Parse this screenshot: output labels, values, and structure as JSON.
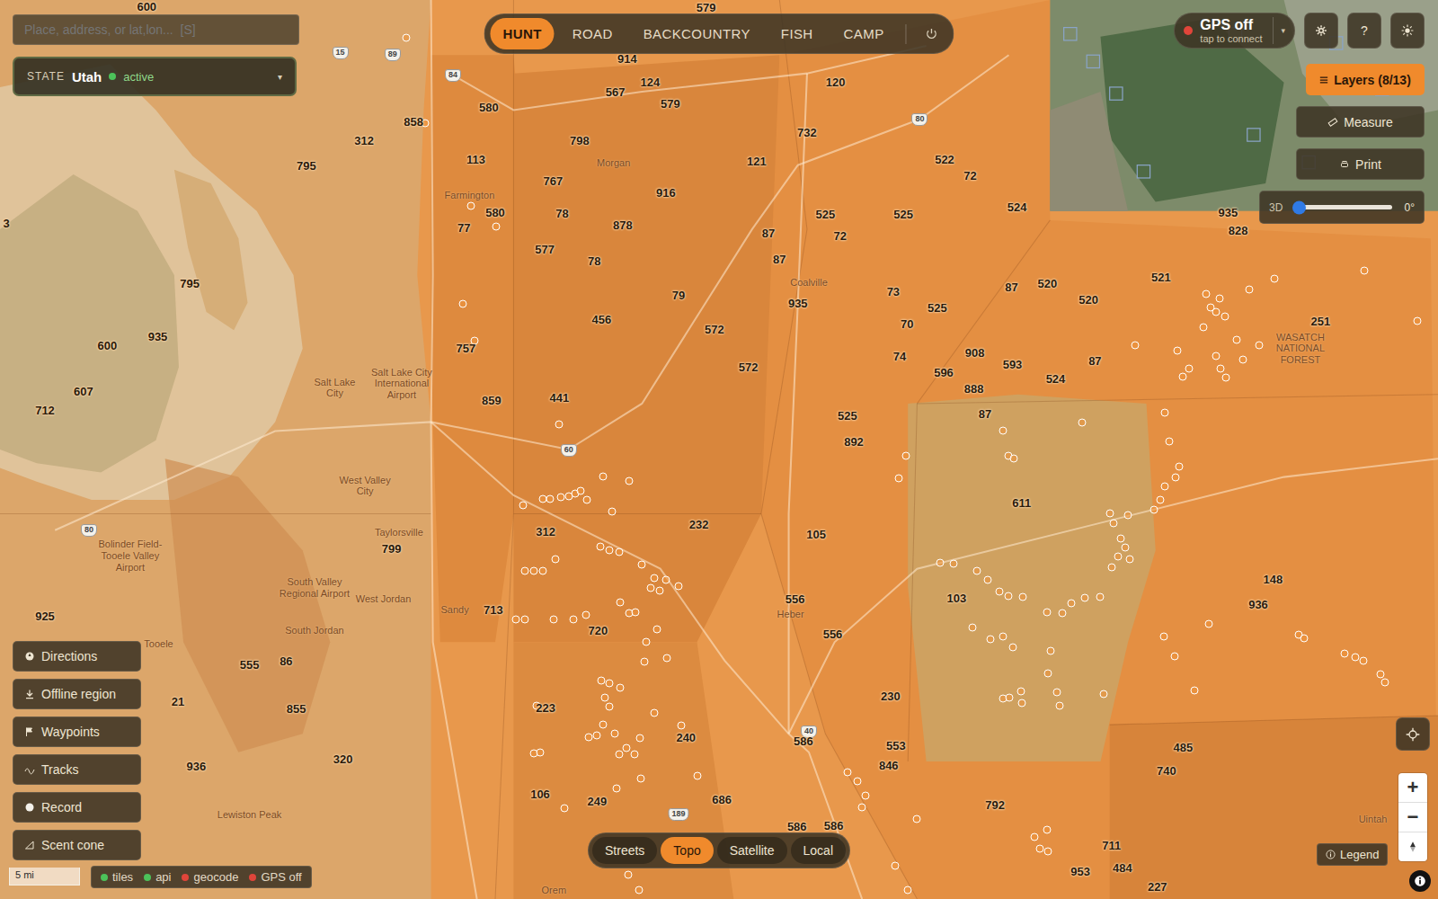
{
  "search": {
    "placeholder": "Place, address, or lat,lon...  [S]"
  },
  "state_selector": {
    "label": "STATE",
    "value": "Utah",
    "status": "active",
    "status_color": "#4cc25a",
    "caret": "▾"
  },
  "modes": [
    {
      "label": "HUNT",
      "selected": true
    },
    {
      "label": "ROAD",
      "selected": false
    },
    {
      "label": "BACKCOUNTRY",
      "selected": false
    },
    {
      "label": "FISH",
      "selected": false
    },
    {
      "label": "CAMP",
      "selected": false
    }
  ],
  "gps": {
    "title": "GPS off",
    "subtitle": "tap to connect",
    "color": "#e0453a",
    "caret": "▾"
  },
  "help": "?",
  "layers": {
    "label": "Layers (8/13)"
  },
  "tools": [
    {
      "label": "Measure"
    },
    {
      "label": "Print"
    }
  ],
  "tilt": {
    "label": "3D",
    "level": 0,
    "reading": "0°"
  },
  "side_buttons": [
    {
      "label": "Directions"
    },
    {
      "label": "Offline region"
    },
    {
      "label": "Waypoints"
    },
    {
      "label": "Tracks"
    },
    {
      "label": "Record"
    },
    {
      "label": "Scent cone"
    }
  ],
  "scale": "5 mi",
  "status": [
    {
      "label": "tiles",
      "color": "#4cc25a"
    },
    {
      "label": "api",
      "color": "#4cc25a"
    },
    {
      "label": "geocode",
      "color": "#e0453a"
    },
    {
      "label": "GPS off",
      "color": "#e0453a"
    }
  ],
  "basemaps": [
    {
      "label": "Streets",
      "selected": false
    },
    {
      "label": "Topo",
      "selected": true
    },
    {
      "label": "Satellite",
      "selected": false
    },
    {
      "label": "Local",
      "selected": false
    }
  ],
  "legend": "Legend",
  "zoom": [
    "+",
    "−"
  ],
  "map": {
    "units": [
      "600",
      "579",
      "914",
      "124",
      "120",
      "567",
      "579",
      "580",
      "858",
      "312",
      "732",
      "798",
      "113",
      "121",
      "522",
      "795",
      "72",
      "767",
      "916",
      "525",
      "525",
      "524",
      "935",
      "828",
      "580",
      "78",
      "77",
      "878",
      "87",
      "72",
      "577",
      "78",
      "87",
      "521",
      "520",
      "87",
      "795",
      "73",
      "520",
      "79",
      "935",
      "525",
      "251",
      "456",
      "70",
      "572",
      "600",
      "935",
      "757",
      "74",
      "908",
      "593",
      "87",
      "596",
      "607",
      "572",
      "524",
      "888",
      "859",
      "441",
      "712",
      "87",
      "525",
      "892",
      "611",
      "232",
      "105",
      "312",
      "799",
      "148",
      "103",
      "556",
      "936",
      "713",
      "720",
      "556",
      "925",
      "555",
      "86",
      "21",
      "230",
      "223",
      "855",
      "240",
      "485",
      "553",
      "586",
      "846",
      "740",
      "320",
      "936",
      "792",
      "106",
      "249",
      "686",
      "586",
      "586",
      "711",
      "953",
      "484",
      "227",
      "3"
    ],
    "places": [
      "Farmington",
      "Morgan",
      "Coalville",
      "Salt Lake City",
      "Salt Lake City International Airport",
      "West Valley City",
      "Taylorsville",
      "South Valley Regional Airport",
      "West Jordan",
      "Sandy",
      "South Jordan",
      "Bolinder Field-Tooele Valley Airport",
      "Tooele",
      "Lewiston Peak",
      "Heber",
      "WASATCH NATIONAL FOREST",
      "Orem",
      "Uintah"
    ],
    "shields": [
      "89",
      "15",
      "84",
      "80",
      "60",
      "80",
      "40",
      "189"
    ]
  }
}
